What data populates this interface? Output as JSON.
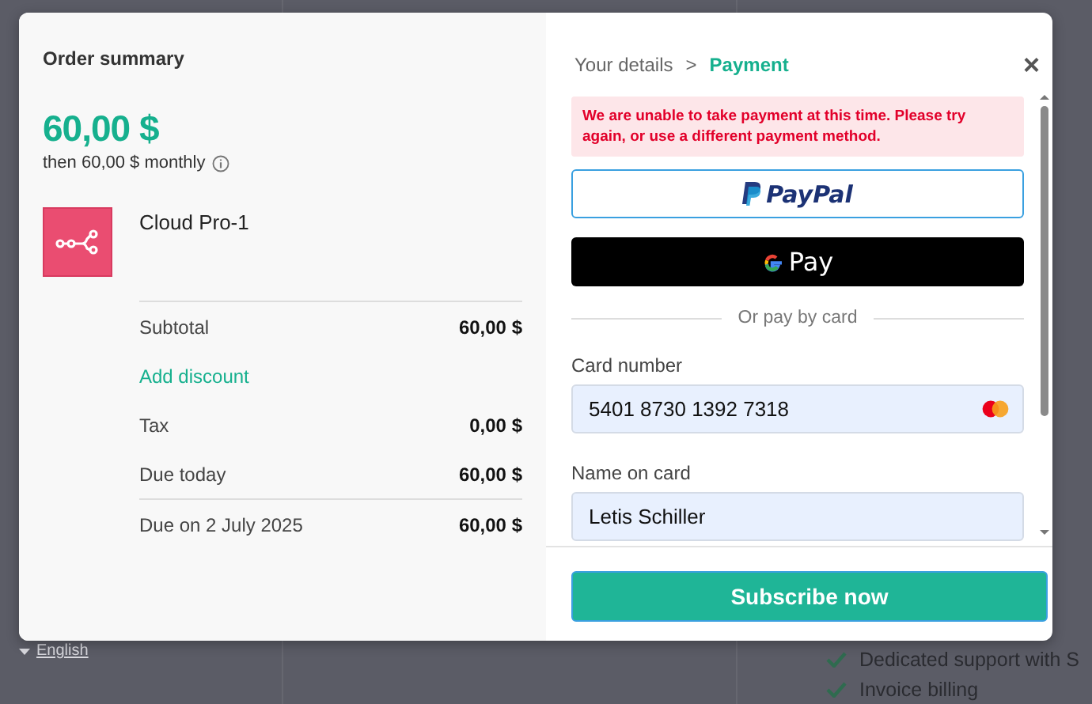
{
  "background": {
    "language_link": "English",
    "features": [
      "Dedicated support with S",
      "Invoice billing"
    ]
  },
  "order_summary": {
    "title": "Order summary",
    "price": "60,00 $",
    "recurring_note": "then 60,00 $ monthly",
    "product": {
      "name": "Cloud Pro-1"
    },
    "rows": [
      {
        "kind": "line",
        "label": "Subtotal",
        "value": "60,00 $",
        "divider_above": true
      },
      {
        "kind": "link",
        "label": "Add discount",
        "divider_above": false
      },
      {
        "kind": "line",
        "label": "Tax",
        "value": "0,00 $",
        "divider_above": false
      },
      {
        "kind": "line",
        "label": "Due today",
        "value": "60,00 $",
        "divider_above": false
      },
      {
        "kind": "line",
        "label": "Due on 2 July 2025",
        "value": "60,00 $",
        "divider_above": true
      }
    ]
  },
  "payment": {
    "breadcrumb": [
      {
        "label": "Your details",
        "selected": false
      },
      {
        "label": "Payment",
        "selected": true
      }
    ],
    "breadcrumb_separator": ">",
    "close": "×",
    "error": "We are unable to take payment at this time. Please try again, or use a different payment method.",
    "wallet_buttons": [
      {
        "kind": "paypal",
        "label": "PayPal"
      },
      {
        "kind": "gpay",
        "label": "Pay"
      }
    ],
    "divider_text": "Or pay by card",
    "fields": [
      {
        "kind": "card",
        "label": "Card number",
        "value": "5401 8730 1392 7318"
      },
      {
        "kind": "text",
        "label": "Name on card",
        "value": "Letis Schiller"
      }
    ],
    "submit": "Subscribe now"
  }
}
